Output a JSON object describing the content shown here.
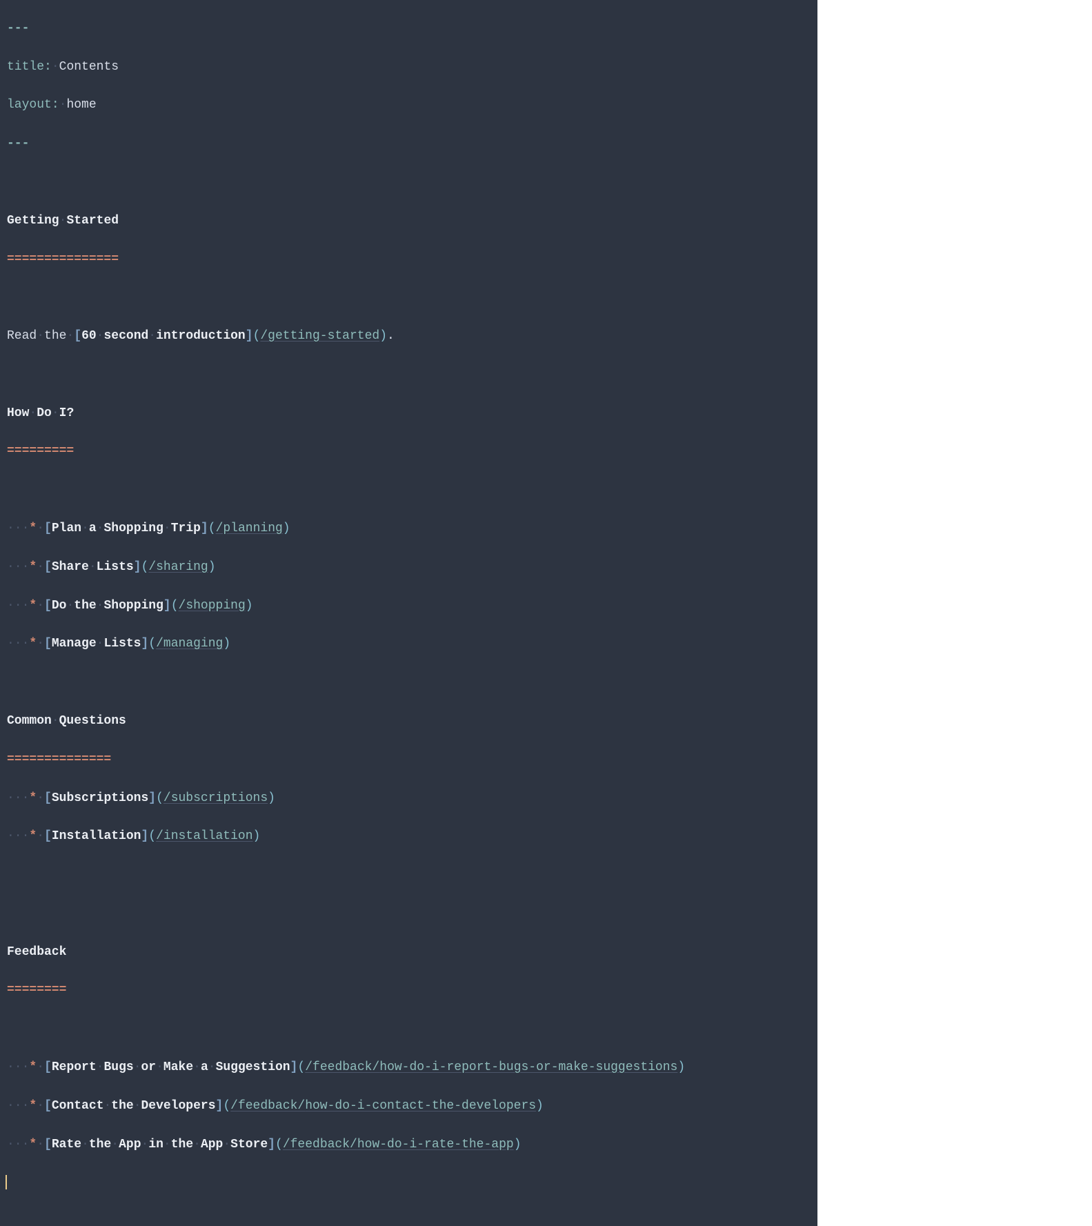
{
  "frontmatter": {
    "delim": "---",
    "title_key": "title",
    "title_val": "Contents",
    "layout_key": "layout",
    "layout_val": "home"
  },
  "intro": {
    "read_the": "Read",
    "the": "the",
    "link_text_60": "60",
    "link_text_second": "second",
    "link_text_intro": "introduction",
    "url": "/getting-started",
    "period": "."
  },
  "sections": {
    "getting_started": {
      "h1": "Getting",
      "h2": "Started",
      "ul": "==============="
    },
    "how_do_i": {
      "h1": "How",
      "h2": "Do",
      "h3": "I?",
      "ul": "========="
    },
    "common_questions": {
      "h1": "Common",
      "h2": "Questions",
      "ul": "=============="
    },
    "feedback": {
      "h1": "Feedback",
      "ul": "========"
    }
  },
  "howdoi_items": [
    {
      "t1": "Plan",
      "t2": "a",
      "t3": "Shopping",
      "t4": "Trip",
      "url": "/planning"
    },
    {
      "t1": "Share",
      "t2": "Lists",
      "url": "/sharing"
    },
    {
      "t1": "Do",
      "t2": "the",
      "t3": "Shopping",
      "url": "/shopping"
    },
    {
      "t1": "Manage",
      "t2": "Lists",
      "url": "/managing"
    }
  ],
  "common_items": [
    {
      "t1": "Subscriptions",
      "url": "/subscriptions"
    },
    {
      "t1": "Installation",
      "url": "/installation"
    }
  ],
  "feedback_items": [
    {
      "t1": "Report",
      "t2": "Bugs",
      "t3": "or",
      "t4": "Make",
      "t5": "a",
      "t6": "Suggestion",
      "url_pre": "/feedback/",
      "url": "how-do-i-report-bugs-or-make-suggestions"
    },
    {
      "t1": "Contact",
      "t2": "the",
      "t3": "Developers",
      "url_pre": "/feedback/",
      "url": "how-do-i-contact-the-developers"
    },
    {
      "t1": "Rate",
      "t2": "the",
      "t3": "App",
      "t4": "in",
      "t5": "the",
      "t6": "App",
      "t7": "Store",
      "url_pre": "/feedback/",
      "url": "how-do-i-rate-the-app"
    }
  ],
  "ws": {
    "dot": "·",
    "indent": "···"
  }
}
